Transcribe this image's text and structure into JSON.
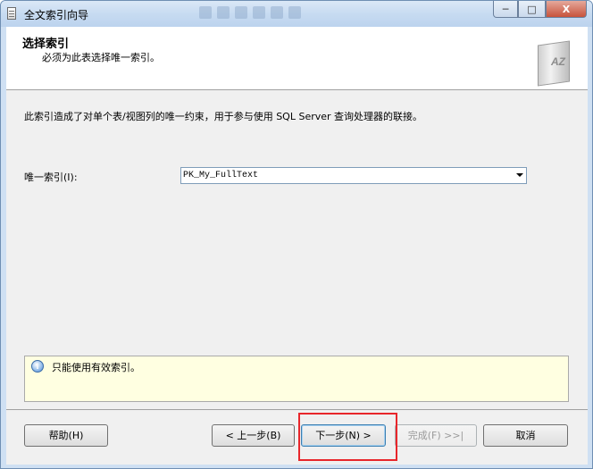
{
  "window": {
    "title": "全文索引向导",
    "controls": {
      "minimize": "─",
      "maximize": "□",
      "close": "X"
    }
  },
  "header": {
    "title": "选择索引",
    "subtitle": "必须为此表选择唯一索引。",
    "icon": "book-az-icon",
    "icon_label": "AZ"
  },
  "body": {
    "description": "此索引造成了对单个表/视图列的唯一约束，用于参与使用 SQL Server 查询处理器的联接。",
    "unique_index_label": "唯一索引(I):",
    "unique_index_value": "PK_My_FullText"
  },
  "info": {
    "icon": "info-icon",
    "text": "只能使用有效索引。"
  },
  "footer": {
    "help": "帮助(H)",
    "back": "< 上一步(B)",
    "next": "下一步(N) >",
    "finish": "完成(F) >>|",
    "cancel": "取消"
  },
  "colors": {
    "highlight": "#e8262b",
    "info_background": "#ffffe1"
  }
}
